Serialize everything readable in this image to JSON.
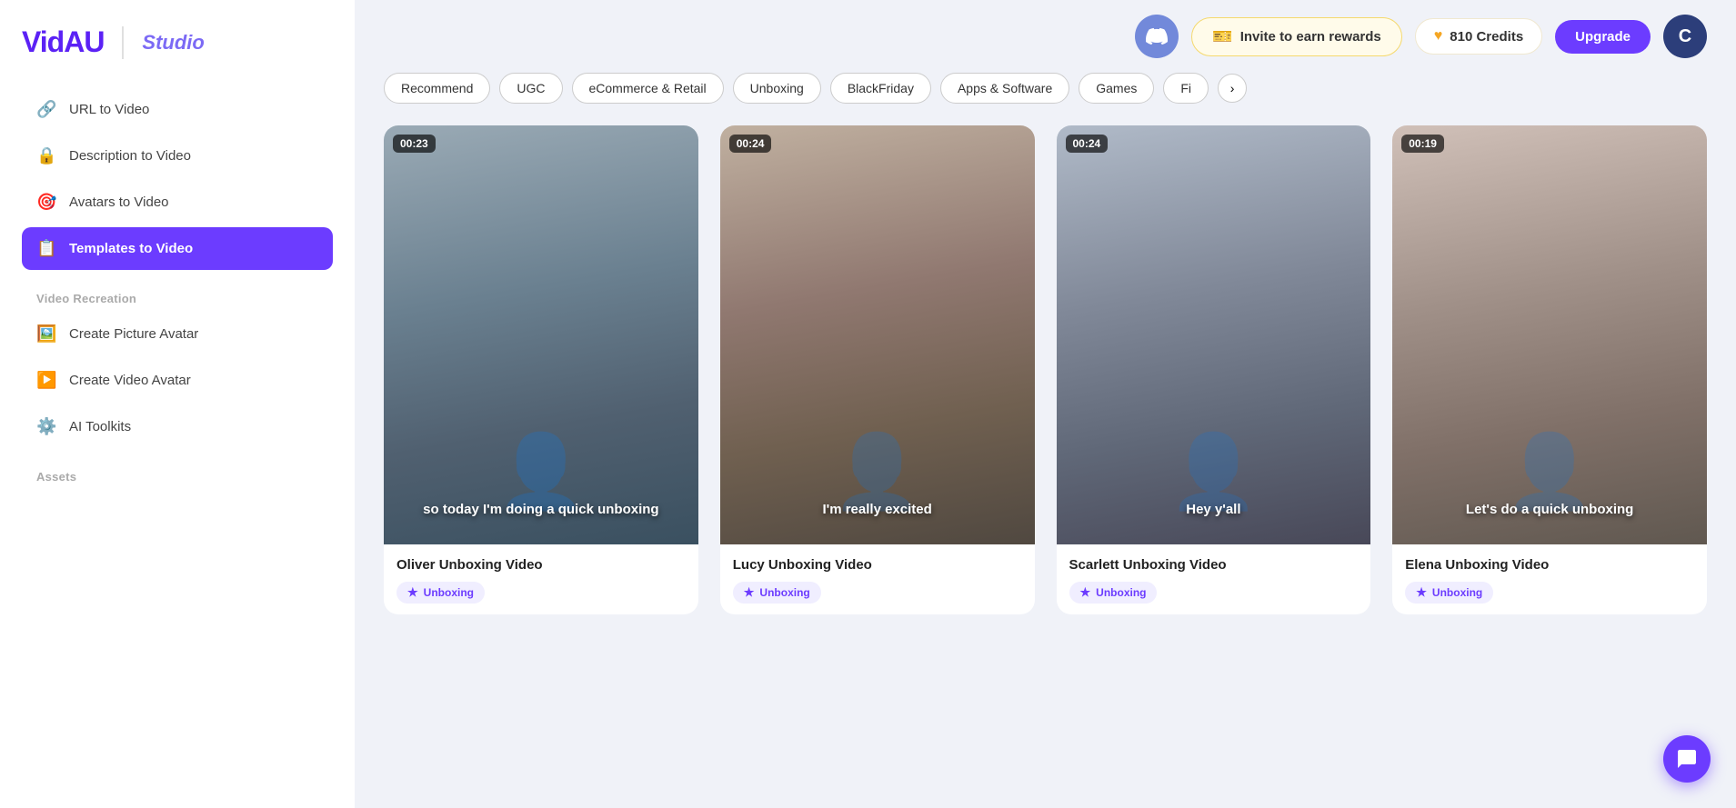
{
  "logo": {
    "brand": "VidAU",
    "separator": "|",
    "studio": "Studio"
  },
  "sidebar": {
    "nav_items": [
      {
        "id": "url-to-video",
        "label": "URL to Video",
        "icon": "🔗",
        "active": false
      },
      {
        "id": "description-to-video",
        "label": "Description to Video",
        "icon": "🔒",
        "active": false
      },
      {
        "id": "avatars-to-video",
        "label": "Avatars to Video",
        "icon": "🎯",
        "active": false
      },
      {
        "id": "templates-to-video",
        "label": "Templates to Video",
        "icon": "📋",
        "active": true
      }
    ],
    "video_recreation_label": "Video Recreation",
    "video_recreation_items": [
      {
        "id": "create-picture-avatar",
        "label": "Create Picture Avatar",
        "icon": "🖼️"
      },
      {
        "id": "create-video-avatar",
        "label": "Create Video Avatar",
        "icon": "▶️"
      },
      {
        "id": "ai-toolkits",
        "label": "AI Toolkits",
        "icon": "⚙️"
      }
    ],
    "assets_label": "Assets"
  },
  "header": {
    "discord_icon": "discord",
    "invite_label": "Invite to earn rewards",
    "invite_icon": "🎫",
    "credits_value": "810 Credits",
    "credits_icon": "♥",
    "upgrade_label": "Upgrade",
    "user_initial": "C"
  },
  "filter_tabs": [
    {
      "id": "recommend",
      "label": "Recommend",
      "active": false
    },
    {
      "id": "ugc",
      "label": "UGC",
      "active": false
    },
    {
      "id": "ecommerce",
      "label": "eCommerce & Retail",
      "active": false
    },
    {
      "id": "unboxing",
      "label": "Unboxing",
      "active": true
    },
    {
      "id": "blackfriday",
      "label": "BlackFriday",
      "active": false
    },
    {
      "id": "apps-software",
      "label": "Apps & Software",
      "active": false
    },
    {
      "id": "games",
      "label": "Games",
      "active": false
    },
    {
      "id": "fi",
      "label": "Fi",
      "active": false
    }
  ],
  "filter_next_icon": "›",
  "videos": [
    {
      "id": "oliver",
      "duration": "00:23",
      "caption": "so today I'm doing a quick unboxing",
      "title": "Oliver Unboxing Video",
      "tag": "Unboxing",
      "thumb_color1": "#7a8f9e",
      "thumb_color2": "#4a6a7e"
    },
    {
      "id": "lucy",
      "duration": "00:24",
      "caption": "I'm really excited",
      "title": "Lucy Unboxing Video",
      "tag": "Unboxing",
      "thumb_color1": "#b8a898",
      "thumb_color2": "#786858"
    },
    {
      "id": "scarlett",
      "duration": "00:24",
      "caption": "Hey y'all",
      "title": "Scarlett Unboxing Video",
      "tag": "Unboxing",
      "thumb_color1": "#9aaab8",
      "thumb_color2": "#606880"
    },
    {
      "id": "elena",
      "duration": "00:19",
      "caption": "Let's do a quick unboxing",
      "title": "Elena Unboxing Video",
      "tag": "Unboxing",
      "thumb_color1": "#c8bab0",
      "thumb_color2": "#807068"
    }
  ],
  "tag_star": "★",
  "chat_icon": "💬"
}
